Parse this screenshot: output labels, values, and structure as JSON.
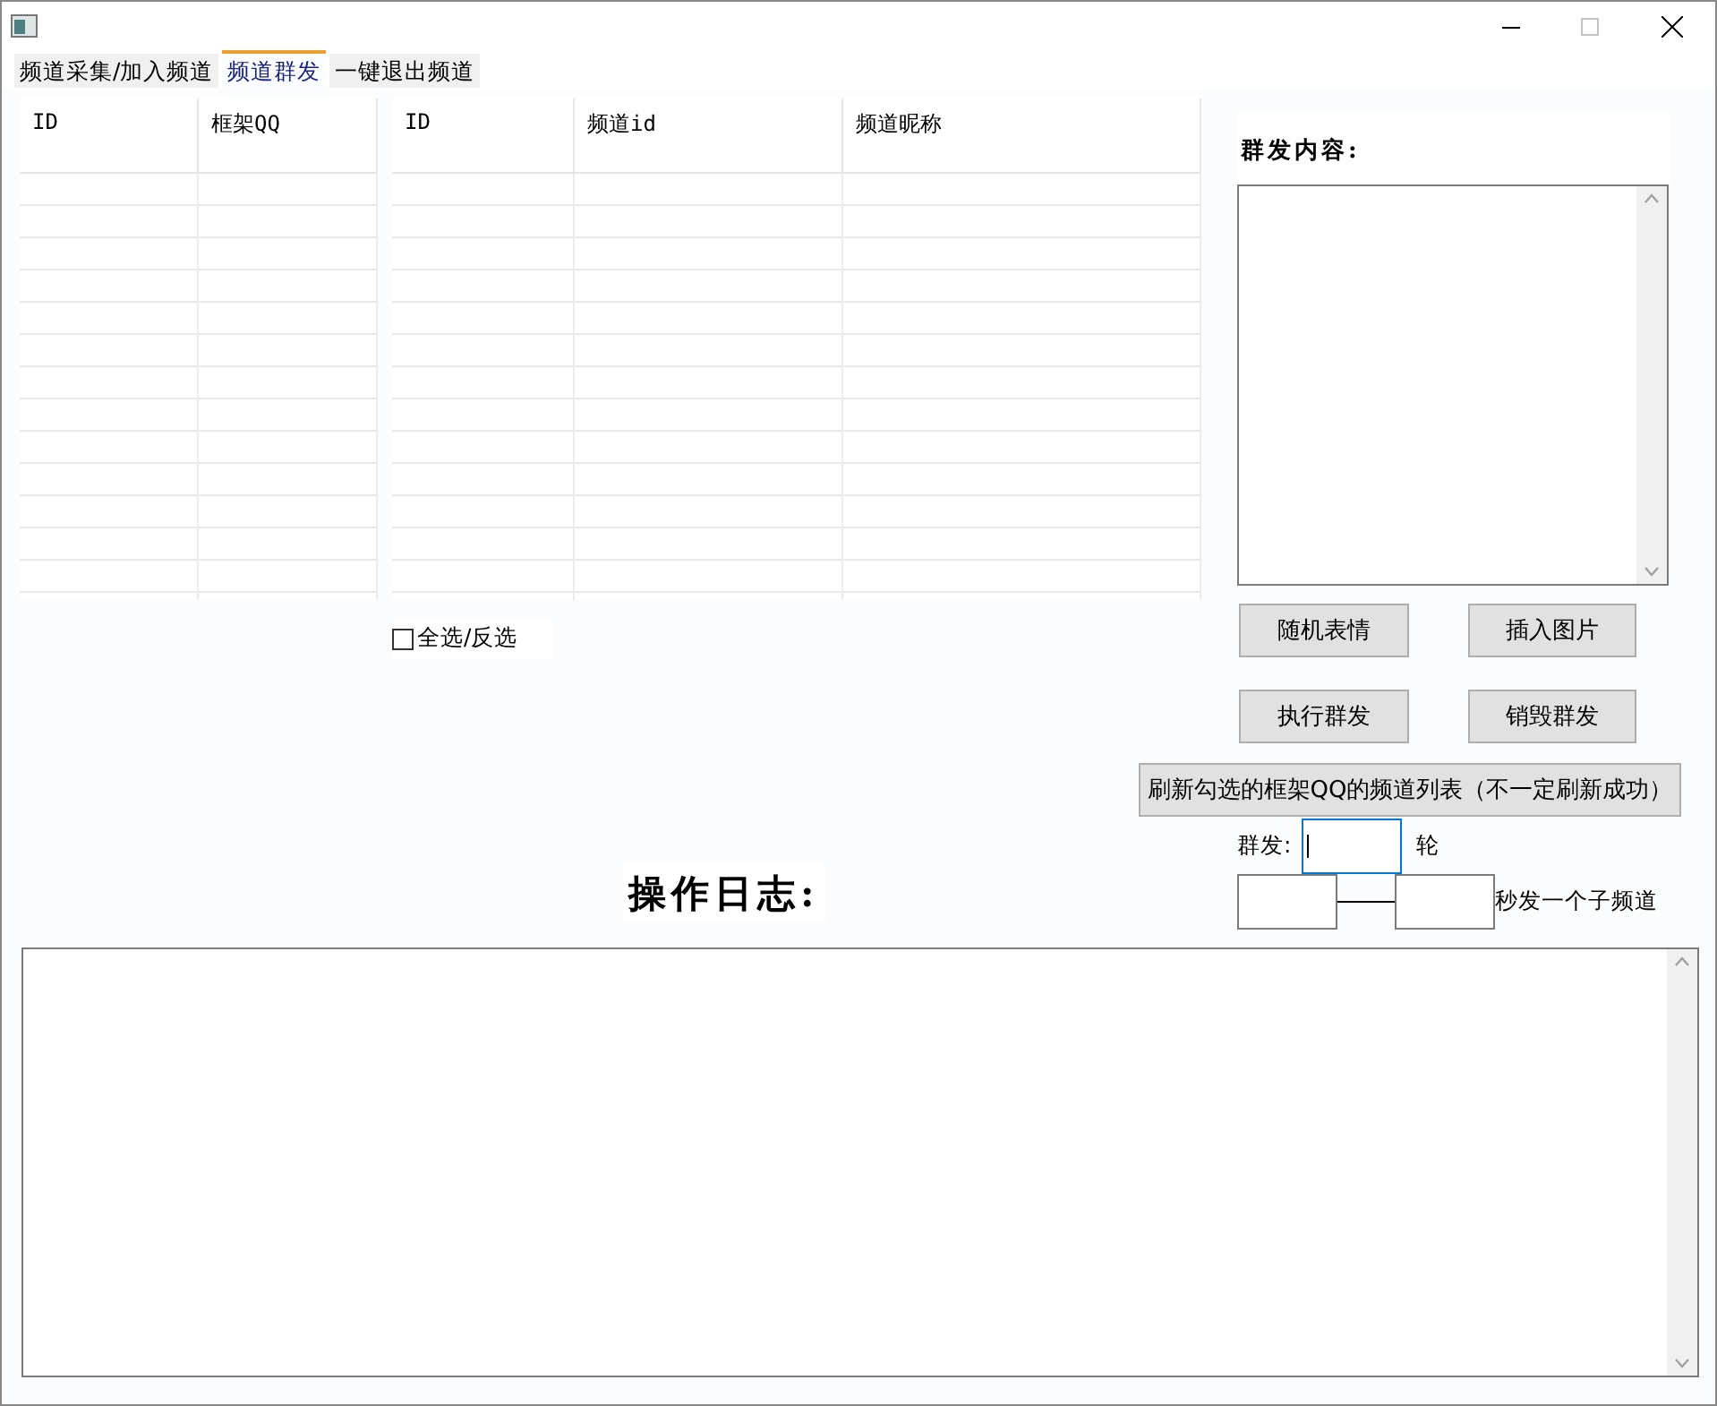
{
  "tabs": [
    {
      "label": "频道采集/加入频道",
      "selected": false
    },
    {
      "label": "频道群发",
      "selected": true
    },
    {
      "label": "一键退出频道",
      "selected": false
    }
  ],
  "framework_table": {
    "columns": [
      "ID",
      "框架QQ"
    ]
  },
  "channel_table": {
    "columns": [
      "ID",
      "频道id",
      "频道昵称"
    ]
  },
  "select_all": {
    "label": "全选/反选",
    "checked": false
  },
  "content_panel": {
    "label": "群发内容:"
  },
  "buttons": [
    {
      "label": "随机表情"
    },
    {
      "label": "插入图片"
    },
    {
      "label": "执行群发"
    },
    {
      "label": "销毁群发"
    }
  ],
  "refresh_button": {
    "label": "刷新勾选的框架QQ的频道列表（不一定刷新成功）"
  },
  "rounds": {
    "label": "群发:",
    "unit": "轮",
    "focused": true
  },
  "interval": {
    "suffix": "秒发一个子频道"
  },
  "log": {
    "title": "操作日志:"
  }
}
